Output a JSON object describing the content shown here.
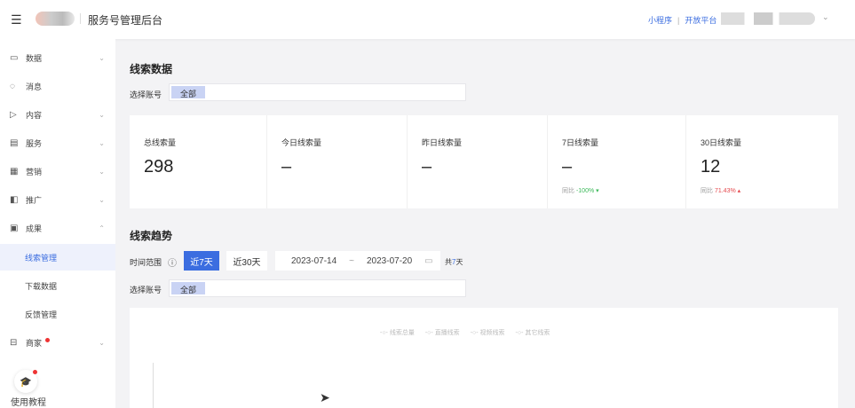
{
  "header": {
    "app_title": "服务号管理后台",
    "links": [
      "小程序",
      "开放平台"
    ]
  },
  "sidebar": {
    "items": [
      {
        "label": "数据",
        "icon": "monitor-icon",
        "arrow": "⌄"
      },
      {
        "label": "消息",
        "icon": "chat-icon",
        "arrow": ""
      },
      {
        "label": "内容",
        "icon": "video-icon",
        "arrow": "⌄"
      },
      {
        "label": "服务",
        "icon": "calendar-icon",
        "arrow": "⌄"
      },
      {
        "label": "营销",
        "icon": "grid-icon",
        "arrow": "⌄"
      },
      {
        "label": "推广",
        "icon": "promote-icon",
        "arrow": "⌄"
      },
      {
        "label": "成果",
        "icon": "result-icon",
        "arrow": "⌃"
      }
    ],
    "sub_items": [
      "线索管理",
      "下载数据",
      "反馈管理"
    ],
    "merchant": "商家",
    "help": "使用教程"
  },
  "leads": {
    "title": "线索数据",
    "account_label": "选择账号",
    "account_value": "全部",
    "stats": [
      {
        "title": "总线索量",
        "value": "298",
        "compare_label": "",
        "compare_value": ""
      },
      {
        "title": "今日线索量",
        "value": "–",
        "compare_label": "",
        "compare_value": ""
      },
      {
        "title": "昨日线索量",
        "value": "–",
        "compare_label": "",
        "compare_value": ""
      },
      {
        "title": "7日线索量",
        "value": "–",
        "compare_label": "同比",
        "compare_value": "-100% ▾"
      },
      {
        "title": "30日线索量",
        "value": "12",
        "compare_label": "同比",
        "compare_value": "71.43% ▴"
      }
    ]
  },
  "trend": {
    "title": "线索趋势",
    "range_label": "时间范围",
    "btn_7": "近7天",
    "btn_30": "近30天",
    "start": "2023-07-14",
    "tilde": "~",
    "end": "2023-07-20",
    "total_prefix": "共",
    "total_days": "7",
    "total_suffix": "天",
    "account_label": "选择账号",
    "account_value": "全部",
    "legend": [
      "线索总量",
      "直播线索",
      "视频线索",
      "其它线索"
    ]
  },
  "colors": {
    "accent": "#3b6de0",
    "down": "#3cb95a",
    "up": "#e5484d"
  }
}
